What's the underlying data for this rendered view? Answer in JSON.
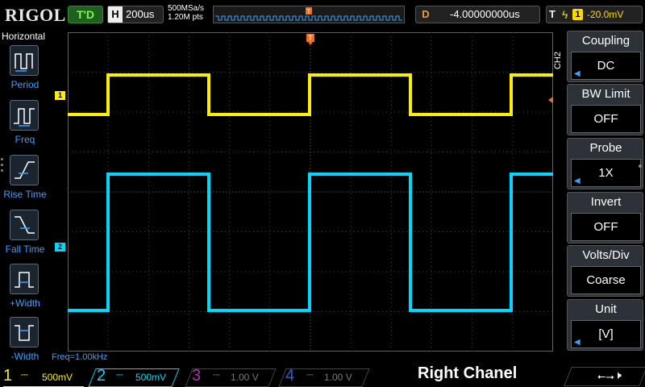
{
  "topbar": {
    "logo": "RIGOL",
    "run_status": "T'D",
    "timebase_label": "H",
    "timebase_value": "200us",
    "sample_rate": "500MSa/s",
    "memory_depth": "1.20M pts",
    "delay_label": "D",
    "delay_value": "-4.00000000us",
    "trigger_label": "T",
    "trigger_source": "1",
    "trigger_level": "-20.0mV",
    "trigger_marker": "T"
  },
  "left_menu": {
    "title": "Horizontal",
    "items": [
      {
        "label": "Period",
        "icon": "period-icon"
      },
      {
        "label": "Freq",
        "icon": "freq-icon"
      },
      {
        "label": "Rise Time",
        "icon": "rise-time-icon"
      },
      {
        "label": "Fall Time",
        "icon": "fall-time-icon"
      },
      {
        "label": "+Width",
        "icon": "positive-width-icon"
      },
      {
        "label": "-Width",
        "icon": "negative-width-icon"
      }
    ]
  },
  "screen": {
    "freq_readout": "Freq=1.00kHz",
    "ch1_marker": "1",
    "ch2_marker": "2",
    "colors": {
      "ch1": "#ffee00",
      "ch2": "#00d8ff",
      "grid": "#404040"
    }
  },
  "right_menu": {
    "channel": "CH2",
    "items": [
      {
        "title": "Coupling",
        "value": "DC"
      },
      {
        "title": "BW Limit",
        "value": "OFF"
      },
      {
        "title": "Probe",
        "value": "1X"
      },
      {
        "title": "Invert",
        "value": "OFF"
      },
      {
        "title": "Volts/Div",
        "value": "Coarse"
      },
      {
        "title": "Unit",
        "value": "[V]"
      }
    ]
  },
  "bottombar": {
    "channels": [
      {
        "num": "1",
        "scale": "500mV"
      },
      {
        "num": "2",
        "scale": "500mV"
      },
      {
        "num": "3",
        "scale": "1.00 V"
      },
      {
        "num": "4",
        "scale": "1.00 V"
      }
    ],
    "title": "Right Chanel"
  }
}
